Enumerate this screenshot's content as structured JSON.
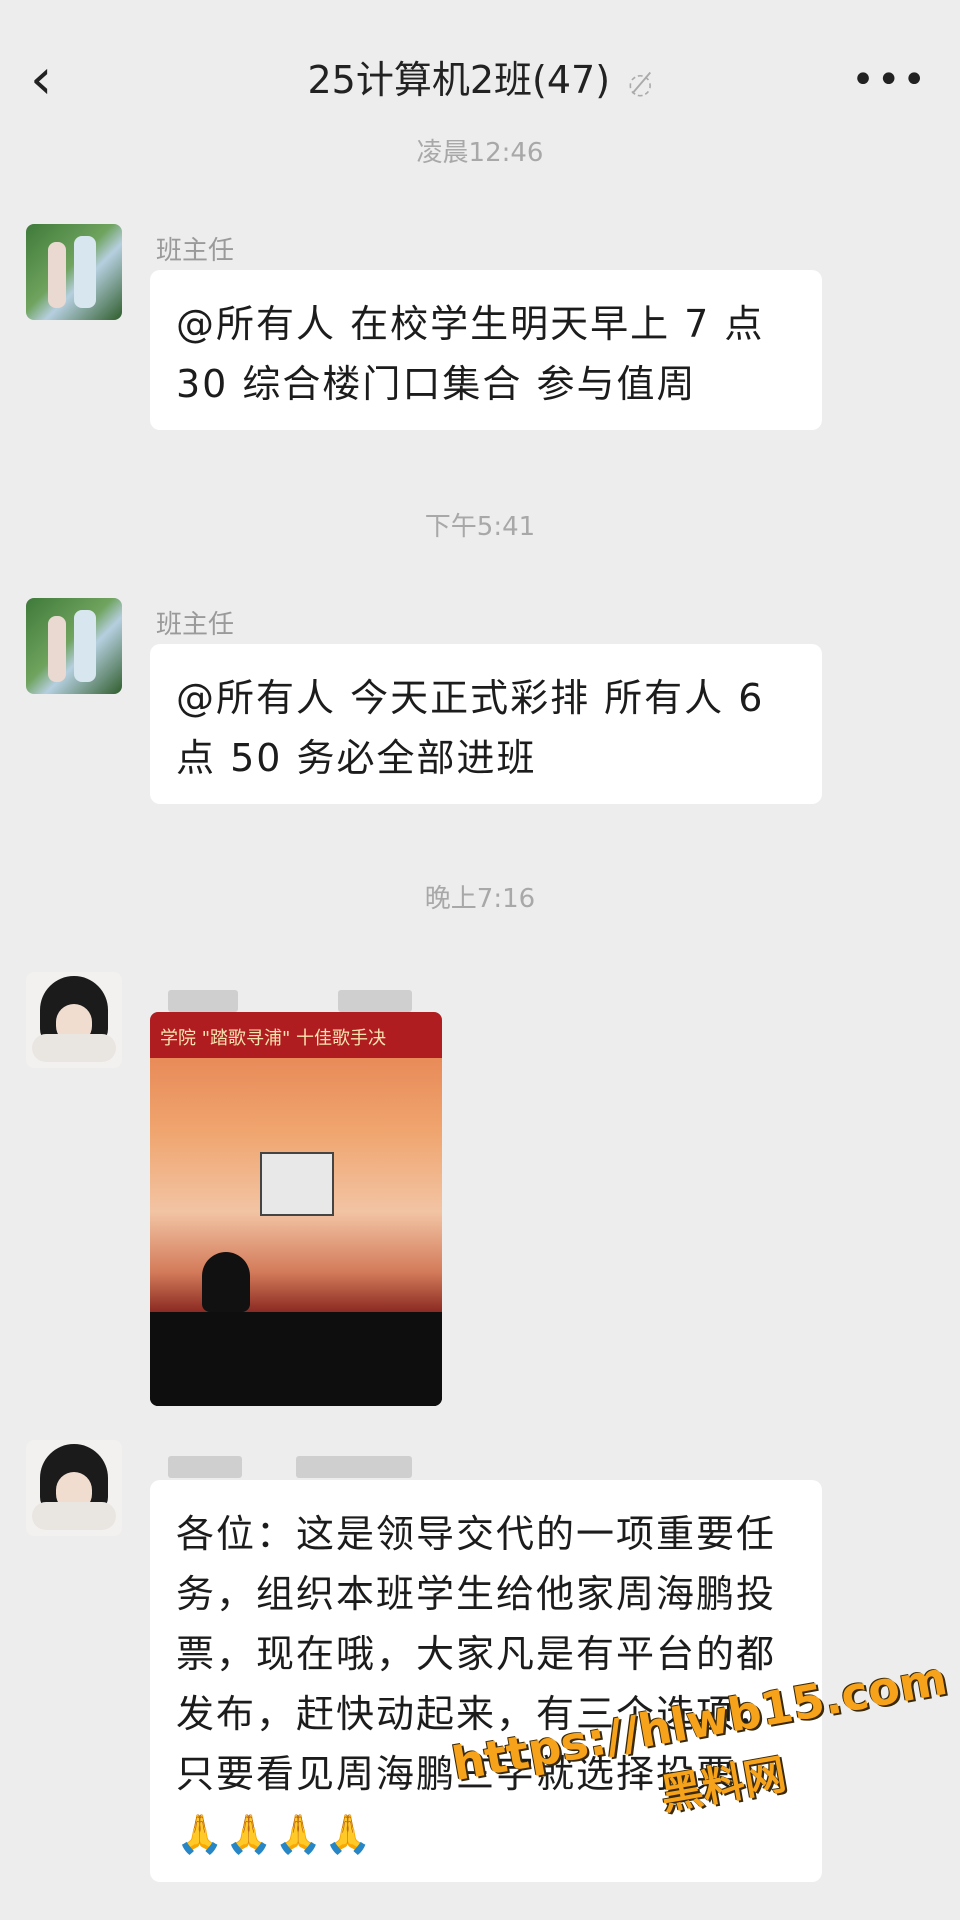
{
  "header": {
    "back_icon": "chevron-left-icon",
    "title": "25计算机2班(47)",
    "mute_icon": "bell-off-icon",
    "more_icon": "more-dots-icon"
  },
  "messages": [
    {
      "time": "凌晨12:46",
      "sender": "班主任",
      "text_lines": [
        "@所有人  在校学生明天早上 7 点",
        "30 综合楼门口集合 参与值周"
      ]
    },
    {
      "time": "下午5:41",
      "sender": "班主任",
      "text_lines": [
        "@所有人  今天正式彩排 所有人 6",
        "点 50 务必全部进班"
      ]
    },
    {
      "time": "晚上7:16",
      "sender": "",
      "image_banner": "学院 \"踏歌寻浦\" 十佳歌手决"
    },
    {
      "sender": "",
      "text_lines": [
        "各位：这是领导交代的一项重要任",
        "务，组织本班学生给他家周海鹏投",
        "票，现在哦，大家凡是有平台的都",
        "发布，赶快动起来，有三个选项，",
        "只要看见周海鹏三字就选择投票",
        "🙏🙏🙏🙏"
      ]
    }
  ],
  "watermark": {
    "url": "https://hlwb15.com",
    "site": "黑料网"
  }
}
